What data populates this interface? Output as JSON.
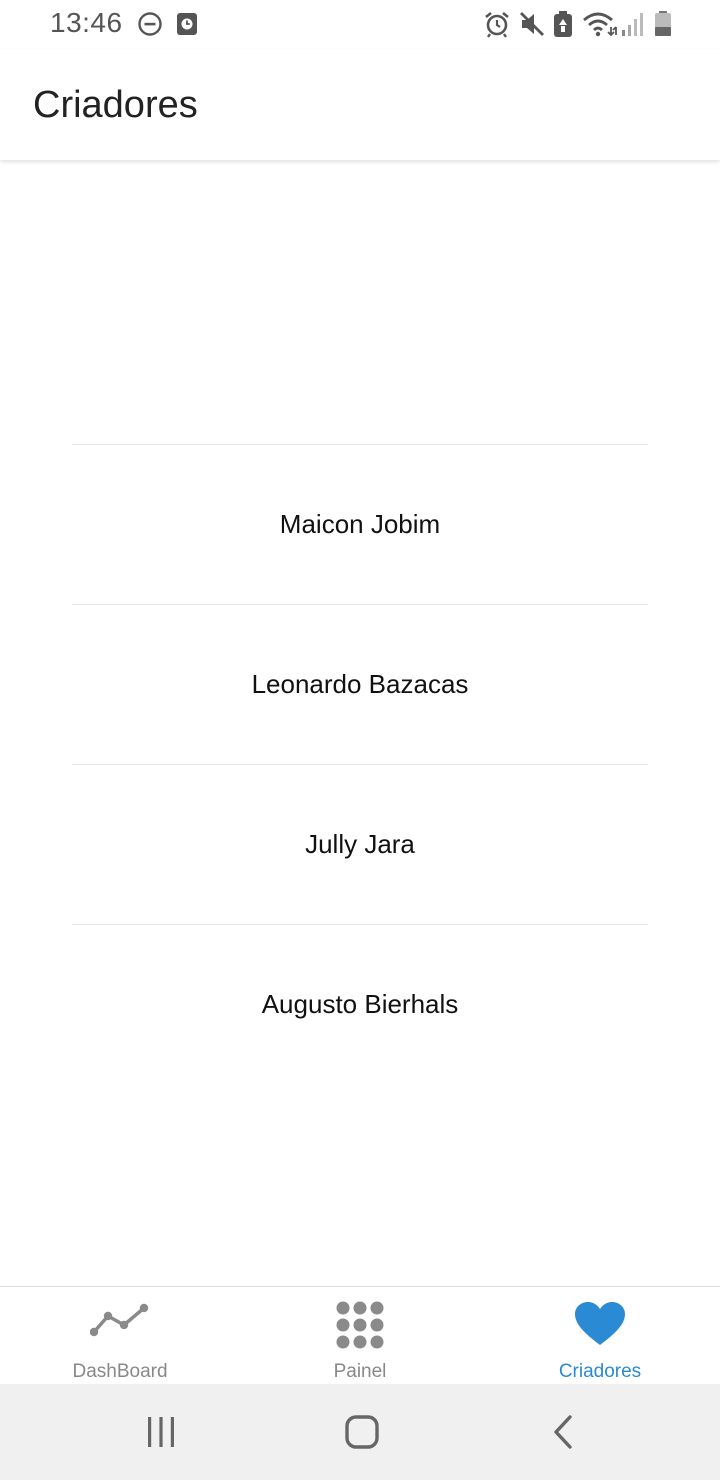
{
  "status_bar": {
    "time": "13:46",
    "left_icons": [
      "do-not-disturb-icon",
      "screen-time-icon"
    ],
    "right_icons": [
      "alarm-icon",
      "mute-icon",
      "battery-saver-icon",
      "wifi-icon",
      "signal-icon",
      "battery-icon"
    ]
  },
  "app_bar": {
    "title": "Criadores"
  },
  "creators": [
    {
      "name": "Maicon Jobim"
    },
    {
      "name": "Leonardo Bazacas"
    },
    {
      "name": "Jully Jara"
    },
    {
      "name": "Augusto Bierhals"
    }
  ],
  "bottom_nav": {
    "tabs": [
      {
        "label": "DashBoard",
        "icon": "line-chart-icon",
        "active": false
      },
      {
        "label": "Painel",
        "icon": "dots-grid-icon",
        "active": false
      },
      {
        "label": "Criadores",
        "icon": "heart-icon",
        "active": true
      }
    ]
  },
  "colors": {
    "accent": "#2a8ad4",
    "inactive": "#888888",
    "divider": "#e6e6e6",
    "system_nav_bg": "#f0f0f0"
  },
  "system_nav": {
    "buttons": [
      "recent-apps-button",
      "home-button",
      "back-button"
    ]
  }
}
